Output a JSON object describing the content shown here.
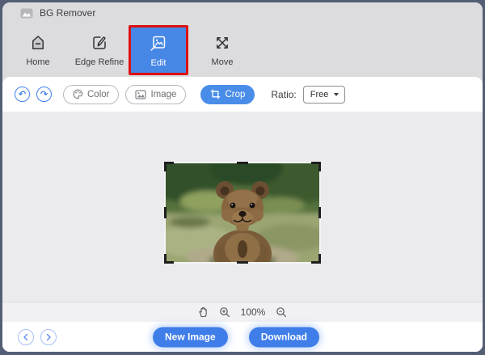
{
  "window": {
    "title": "BG Remover"
  },
  "nav": {
    "items": [
      {
        "label": "Home"
      },
      {
        "label": "Edge Refine"
      },
      {
        "label": "Edit",
        "active": true
      },
      {
        "label": "Move"
      }
    ]
  },
  "toolbar": {
    "color_label": "Color",
    "image_label": "Image",
    "crop_label": "Crop",
    "ratio_label": "Ratio:",
    "ratio_value": "Free"
  },
  "statusbar": {
    "zoom_level": "100%"
  },
  "footer": {
    "new_image_label": "New Image",
    "download_label": "Download"
  },
  "icons": {
    "app": "picture",
    "home": "house-minus",
    "edge_refine": "pen-square",
    "edit": "image-crop",
    "move": "arrows-cross",
    "undo": "arrow-curve-left",
    "redo": "arrow-curve-right",
    "color": "palette",
    "image": "picture",
    "crop": "crop-frame",
    "ratio_caret": "caret-down",
    "hand": "hand",
    "zoom_in": "magnifier-plus",
    "zoom_out": "magnifier-minus",
    "prev": "chevron-left",
    "next": "chevron-right"
  },
  "colors": {
    "accent_blue": "#4787e6",
    "crop_button_blue": "#4a8de9",
    "active_outline_red": "#dd1111",
    "window_chrome_gray": "#dcdcdf",
    "canvas_gray": "#ebebed",
    "desktop_dark": "#545e75"
  }
}
